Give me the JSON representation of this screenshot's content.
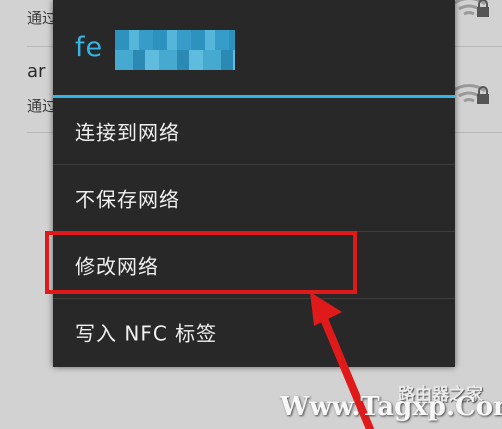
{
  "background": {
    "rows": [
      {
        "subtitle": "通过"
      },
      {
        "subtitle": "通过",
        "name_fragment": "ar"
      }
    ]
  },
  "dialog": {
    "title": "fe",
    "menu": [
      {
        "label": "连接到网络"
      },
      {
        "label": "不保存网络"
      },
      {
        "label": "修改网络"
      },
      {
        "label": "写入 NFC 标签"
      }
    ]
  },
  "watermark": {
    "site": "路由器之家",
    "url": "Www.Tagxp.Com"
  },
  "colors": {
    "accent": "#33b5e5",
    "highlight": "#e01a1a",
    "dialog_bg": "#282828"
  },
  "icons": [
    "wifi-lock-icon",
    "arrow-annotation-icon"
  ]
}
